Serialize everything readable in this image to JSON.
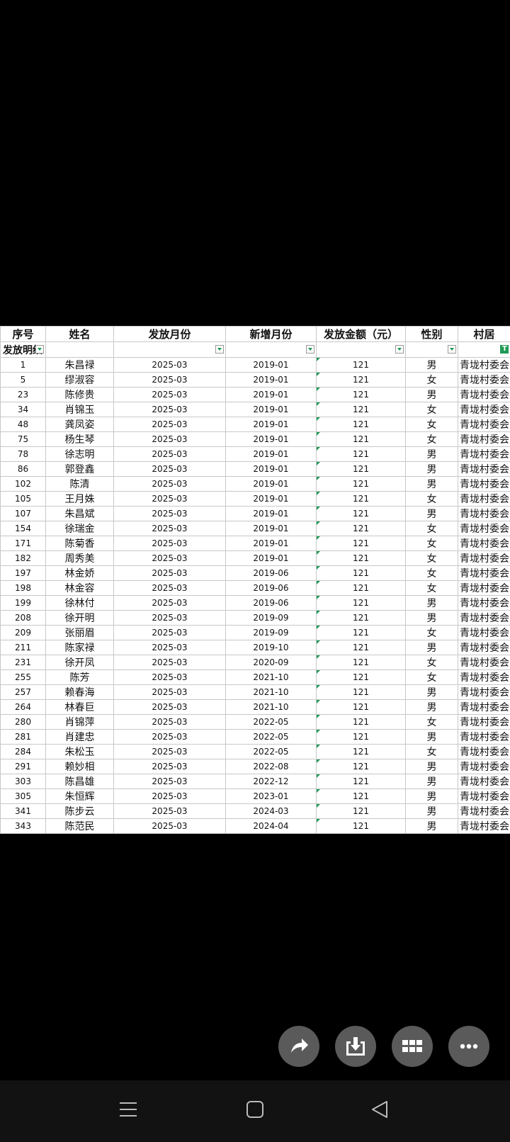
{
  "table": {
    "headers": [
      "序号",
      "姓名",
      "发放月份",
      "新增月份",
      "发放金额（元）",
      "性别",
      "村居"
    ],
    "filter_label": "发放明细",
    "rows": [
      [
        "1",
        "朱昌禄",
        "2025-03",
        "2019-01",
        "121",
        "男",
        "青垅村委会"
      ],
      [
        "5",
        "缪淑容",
        "2025-03",
        "2019-01",
        "121",
        "女",
        "青垅村委会"
      ],
      [
        "23",
        "陈修贵",
        "2025-03",
        "2019-01",
        "121",
        "男",
        "青垅村委会"
      ],
      [
        "34",
        "肖锦玉",
        "2025-03",
        "2019-01",
        "121",
        "女",
        "青垅村委会"
      ],
      [
        "48",
        "龚凤姿",
        "2025-03",
        "2019-01",
        "121",
        "女",
        "青垅村委会"
      ],
      [
        "75",
        "杨生琴",
        "2025-03",
        "2019-01",
        "121",
        "女",
        "青垅村委会"
      ],
      [
        "78",
        "徐志明",
        "2025-03",
        "2019-01",
        "121",
        "男",
        "青垅村委会"
      ],
      [
        "86",
        "郭登鑫",
        "2025-03",
        "2019-01",
        "121",
        "男",
        "青垅村委会"
      ],
      [
        "102",
        "陈清",
        "2025-03",
        "2019-01",
        "121",
        "男",
        "青垅村委会"
      ],
      [
        "105",
        "王月姝",
        "2025-03",
        "2019-01",
        "121",
        "女",
        "青垅村委会"
      ],
      [
        "107",
        "朱昌斌",
        "2025-03",
        "2019-01",
        "121",
        "男",
        "青垅村委会"
      ],
      [
        "154",
        "徐瑞金",
        "2025-03",
        "2019-01",
        "121",
        "女",
        "青垅村委会"
      ],
      [
        "171",
        "陈菊香",
        "2025-03",
        "2019-01",
        "121",
        "女",
        "青垅村委会"
      ],
      [
        "182",
        "周秀美",
        "2025-03",
        "2019-01",
        "121",
        "女",
        "青垅村委会"
      ],
      [
        "197",
        "林金娇",
        "2025-03",
        "2019-06",
        "121",
        "女",
        "青垅村委会"
      ],
      [
        "198",
        "林金容",
        "2025-03",
        "2019-06",
        "121",
        "女",
        "青垅村委会"
      ],
      [
        "199",
        "徐林付",
        "2025-03",
        "2019-06",
        "121",
        "男",
        "青垅村委会"
      ],
      [
        "208",
        "徐开明",
        "2025-03",
        "2019-09",
        "121",
        "男",
        "青垅村委会"
      ],
      [
        "209",
        "张丽眉",
        "2025-03",
        "2019-09",
        "121",
        "女",
        "青垅村委会"
      ],
      [
        "211",
        "陈家禄",
        "2025-03",
        "2019-10",
        "121",
        "男",
        "青垅村委会"
      ],
      [
        "231",
        "徐开凤",
        "2025-03",
        "2020-09",
        "121",
        "女",
        "青垅村委会"
      ],
      [
        "255",
        "陈芳",
        "2025-03",
        "2021-10",
        "121",
        "女",
        "青垅村委会"
      ],
      [
        "257",
        "赖春海",
        "2025-03",
        "2021-10",
        "121",
        "男",
        "青垅村委会"
      ],
      [
        "264",
        "林春巨",
        "2025-03",
        "2021-10",
        "121",
        "男",
        "青垅村委会"
      ],
      [
        "280",
        "肖锦萍",
        "2025-03",
        "2022-05",
        "121",
        "女",
        "青垅村委会"
      ],
      [
        "281",
        "肖建忠",
        "2025-03",
        "2022-05",
        "121",
        "男",
        "青垅村委会"
      ],
      [
        "284",
        "朱松玉",
        "2025-03",
        "2022-05",
        "121",
        "女",
        "青垅村委会"
      ],
      [
        "291",
        "赖妙相",
        "2025-03",
        "2022-08",
        "121",
        "男",
        "青垅村委会"
      ],
      [
        "303",
        "陈昌雄",
        "2025-03",
        "2022-12",
        "121",
        "男",
        "青垅村委会"
      ],
      [
        "305",
        "朱恒辉",
        "2025-03",
        "2023-01",
        "121",
        "男",
        "青垅村委会"
      ],
      [
        "341",
        "陈步云",
        "2025-03",
        "2024-03",
        "121",
        "男",
        "青垅村委会"
      ],
      [
        "343",
        "陈范民",
        "2025-03",
        "2024-04",
        "121",
        "男",
        "青垅村委会"
      ]
    ]
  },
  "actions": [
    "share-icon",
    "download-icon",
    "grid-icon",
    "more-icon"
  ],
  "colors": {
    "accent": "#1f9a55",
    "button_bg": "#5a5a5a"
  }
}
